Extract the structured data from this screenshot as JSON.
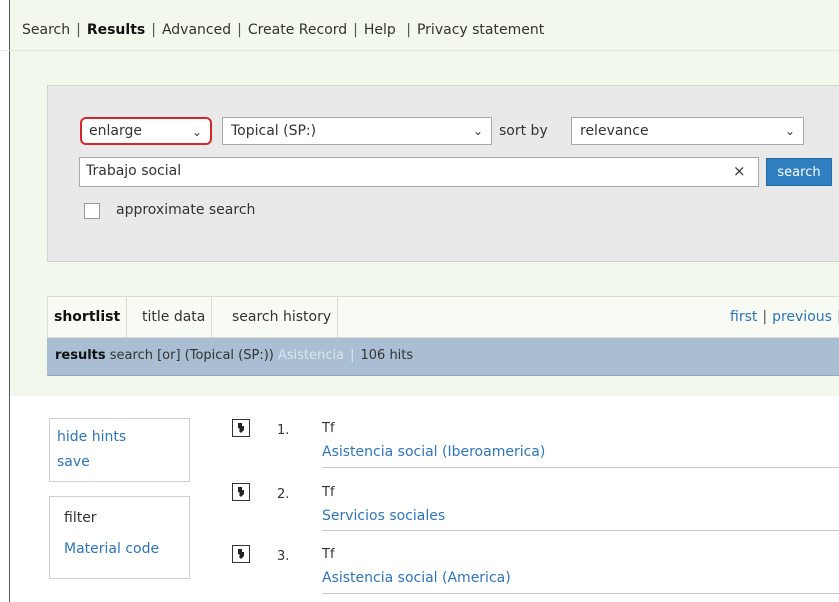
{
  "nav": {
    "items": [
      {
        "label": "Search",
        "active": false
      },
      {
        "label": "Results",
        "active": true
      },
      {
        "label": "Advanced",
        "active": false
      },
      {
        "label": "Create Record",
        "active": false
      },
      {
        "label": "Help",
        "active": false
      },
      {
        "label": "Privacy statement",
        "active": false
      }
    ]
  },
  "search": {
    "mode": "enlarge",
    "field": "Topical (SP:)",
    "sort_label": "sort by",
    "sort": "relevance",
    "query": "Trabajo social",
    "clear": "×",
    "button": "search",
    "approximate_label": "approximate search",
    "approximate_checked": false
  },
  "tabs": {
    "shortlist": "shortlist",
    "title_data": "title data",
    "search_history": "search history"
  },
  "pager": {
    "first": "first",
    "previous": "previous"
  },
  "results_bar": {
    "label": "results",
    "query_desc": "search [or] (Topical (SP:))",
    "term": "Asistencia",
    "hits": "106 hits"
  },
  "hints": {
    "hide_hints": "hide hints",
    "save": "save"
  },
  "filter": {
    "title": "filter",
    "material_code": "Material code"
  },
  "results": [
    {
      "num": "1.",
      "type": "Tf",
      "title": "Asistencia social (Iberoamerica)"
    },
    {
      "num": "2.",
      "type": "Tf",
      "title": "Servicios sociales"
    },
    {
      "num": "3.",
      "type": "Tf",
      "title": "Asistencia social (America)"
    }
  ],
  "colors": {
    "page_bg": "#f2f9ec",
    "link": "#2f74b5",
    "search_button": "#2f7ebf",
    "results_bar": "#a9bdd3",
    "highlight_outline": "#d6262b"
  }
}
